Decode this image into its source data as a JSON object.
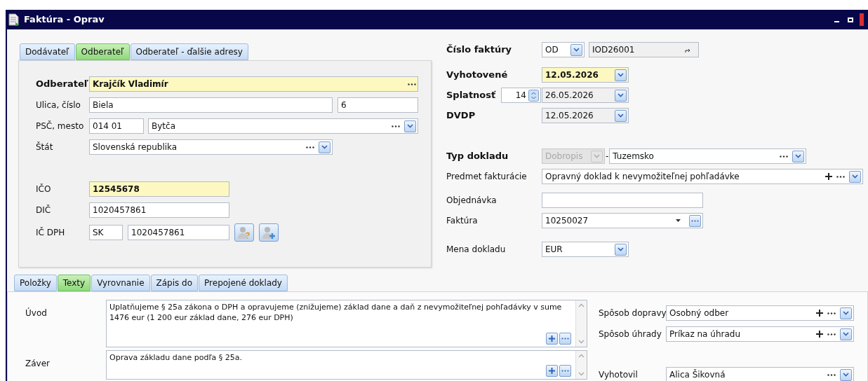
{
  "window": {
    "title": "Faktúra - Oprav"
  },
  "customer_tabs": [
    {
      "label": "Dodávateľ",
      "selected": false
    },
    {
      "label": "Odberateľ",
      "selected": true
    },
    {
      "label": "Odberateľ - ďalšie adresy",
      "selected": false
    }
  ],
  "customer": {
    "name": {
      "label": "Odberateľ",
      "value": "Krajčík Vladimír"
    },
    "street": {
      "label": "Ulica, číslo",
      "value": "Biela",
      "number": "6"
    },
    "city": {
      "label": "PSČ, mesto",
      "zip": "014 01",
      "value": "Bytča"
    },
    "country": {
      "label": "Štát",
      "value": "Slovenská republika"
    },
    "ico": {
      "label": "IČO",
      "value": "12545678"
    },
    "dic": {
      "label": "DIČ",
      "value": "1020457861"
    },
    "ic_dph": {
      "label": "IČ DPH",
      "prefix": "SK",
      "value": "1020457861"
    }
  },
  "header": {
    "invoice_number": {
      "label": "Číslo faktúry",
      "series": "OD",
      "value": "IOD26001"
    },
    "issued": {
      "label": "Vyhotovené",
      "value": "12.05.2026"
    },
    "due": {
      "label": "Splatnosť",
      "days": "14",
      "value": "26.05.2026"
    },
    "dvdp": {
      "label": "DVDP",
      "value": "12.05.2026"
    },
    "doc_type": {
      "label": "Typ dokladu",
      "type": "Dobropis",
      "type_disabled": true,
      "separator": "-",
      "region": "Tuzemsko"
    },
    "subject": {
      "label": "Predmet fakturácie",
      "value": "Opravný doklad k nevymožiteľnej pohľadávke"
    },
    "order": {
      "label": "Objednávka"
    },
    "invoice": {
      "label": "Faktúra",
      "value": "10250027"
    },
    "currency": {
      "label": "Mena dokladu",
      "value": "EUR"
    }
  },
  "bottom_tabs": [
    {
      "label": "Položky",
      "selected": false
    },
    {
      "label": "Texty",
      "selected": true
    },
    {
      "label": "Vyrovnanie",
      "selected": false
    },
    {
      "label": "Zápis do",
      "selected": false
    },
    {
      "label": "Prepojené doklady",
      "selected": false
    }
  ],
  "texts": [
    {
      "label": "Úvod",
      "value": "Uplatňujeme § 25a zákona o DPH a opravujeme (znižujeme) základ dane a daň z nevymožiteľnej pohľadávky v sume 1476 eur (1 200 eur základ dane, 276 eur DPH)"
    },
    {
      "label": "Záver",
      "value": "Oprava základu dane podľa § 25a."
    }
  ],
  "delivery": {
    "transport": {
      "label": "Spôsob dopravy",
      "value": "Osobný odber"
    },
    "payment": {
      "label": "Spôsob úhrady",
      "value": "Príkaz na úhradu"
    },
    "issued_by": {
      "label": "Vyhotovil",
      "value": "Alica Šikovná"
    }
  }
}
